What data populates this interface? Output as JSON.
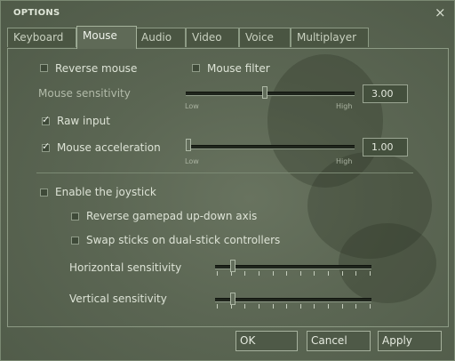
{
  "window": {
    "title": "OPTIONS",
    "close_glyph": "×"
  },
  "tabs": [
    {
      "label": "Keyboard",
      "active": false
    },
    {
      "label": "Mouse",
      "active": true
    },
    {
      "label": "Audio",
      "active": false
    },
    {
      "label": "Video",
      "active": false
    },
    {
      "label": "Voice",
      "active": false
    },
    {
      "label": "Multiplayer",
      "active": false
    }
  ],
  "mouse": {
    "reverse_mouse": {
      "label": "Reverse mouse",
      "checked": false
    },
    "mouse_filter": {
      "label": "Mouse filter",
      "checked": false
    },
    "sensitivity": {
      "label": "Mouse sensitivity",
      "value": "3.00",
      "level": 0.47,
      "low": "Low",
      "high": "High"
    },
    "raw_input": {
      "label": "Raw input",
      "checked": true
    },
    "acceleration": {
      "label": "Mouse acceleration",
      "checked": true,
      "value": "1.00",
      "level": 0.0,
      "low": "Low",
      "high": "High"
    }
  },
  "joystick": {
    "enable": {
      "label": "Enable the joystick",
      "checked": false
    },
    "reverse_gamepad": {
      "label": "Reverse gamepad up-down axis",
      "checked": false
    },
    "swap_sticks": {
      "label": "Swap sticks on dual-stick controllers",
      "checked": false
    },
    "horizontal": {
      "label": "Horizontal sensitivity",
      "level": 0.1
    },
    "vertical": {
      "label": "Vertical sensitivity",
      "level": 0.1
    }
  },
  "buttons": {
    "ok": "OK",
    "cancel": "Cancel",
    "apply": "Apply"
  },
  "colors": {
    "window_bg": "#5b6653",
    "text": "#dde3d6",
    "border": "#8c9a84"
  }
}
